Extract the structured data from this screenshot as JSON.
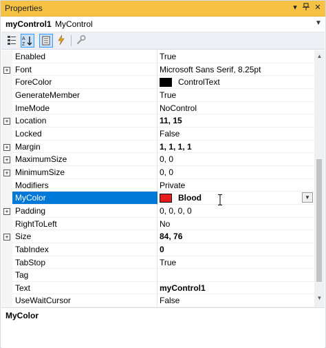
{
  "window": {
    "title": "Properties"
  },
  "object_selector": {
    "name": "myControl1",
    "type": "MyControl"
  },
  "toolbar": {
    "buttons": [
      {
        "name": "categorized-icon",
        "active": false
      },
      {
        "name": "alphabetical-icon",
        "active": true
      },
      {
        "name": "properties-icon",
        "active": true
      },
      {
        "name": "events-icon",
        "active": false
      },
      {
        "name": "property-pages-icon",
        "active": false
      }
    ]
  },
  "colors": {
    "titlebar": "#f6c244",
    "selection": "#0078d7",
    "fore_color_swatch": "#000000",
    "mycolor_swatch": "#e81b1b"
  },
  "properties": [
    {
      "name": "Enabled",
      "value": "True",
      "expandable": false,
      "bold": false
    },
    {
      "name": "Font",
      "value": "Microsoft Sans Serif, 8.25pt",
      "expandable": true,
      "bold": false
    },
    {
      "name": "ForeColor",
      "value": "ControlText",
      "expandable": false,
      "bold": false,
      "swatch": "#000000"
    },
    {
      "name": "GenerateMember",
      "value": "True",
      "expandable": false,
      "bold": false
    },
    {
      "name": "ImeMode",
      "value": "NoControl",
      "expandable": false,
      "bold": false
    },
    {
      "name": "Location",
      "value": "11, 15",
      "expandable": true,
      "bold": true
    },
    {
      "name": "Locked",
      "value": "False",
      "expandable": false,
      "bold": false
    },
    {
      "name": "Margin",
      "value": "1, 1, 1, 1",
      "expandable": true,
      "bold": true
    },
    {
      "name": "MaximumSize",
      "value": "0, 0",
      "expandable": true,
      "bold": false
    },
    {
      "name": "MinimumSize",
      "value": "0, 0",
      "expandable": true,
      "bold": false
    },
    {
      "name": "Modifiers",
      "value": "Private",
      "expandable": false,
      "bold": false
    },
    {
      "name": "MyColor",
      "value": "Blood",
      "expandable": false,
      "bold": true,
      "swatch": "#e81b1b",
      "selected": true
    },
    {
      "name": "Padding",
      "value": "0, 0, 0, 0",
      "expandable": true,
      "bold": false
    },
    {
      "name": "RightToLeft",
      "value": "No",
      "expandable": false,
      "bold": false
    },
    {
      "name": "Size",
      "value": "84, 76",
      "expandable": true,
      "bold": true
    },
    {
      "name": "TabIndex",
      "value": "0",
      "expandable": false,
      "bold": true
    },
    {
      "name": "TabStop",
      "value": "True",
      "expandable": false,
      "bold": false
    },
    {
      "name": "Tag",
      "value": "",
      "expandable": false,
      "bold": false
    },
    {
      "name": "Text",
      "value": "myControl1",
      "expandable": false,
      "bold": true
    },
    {
      "name": "UseWaitCursor",
      "value": "False",
      "expandable": false,
      "bold": false
    }
  ],
  "description": {
    "title": "MyColor"
  }
}
